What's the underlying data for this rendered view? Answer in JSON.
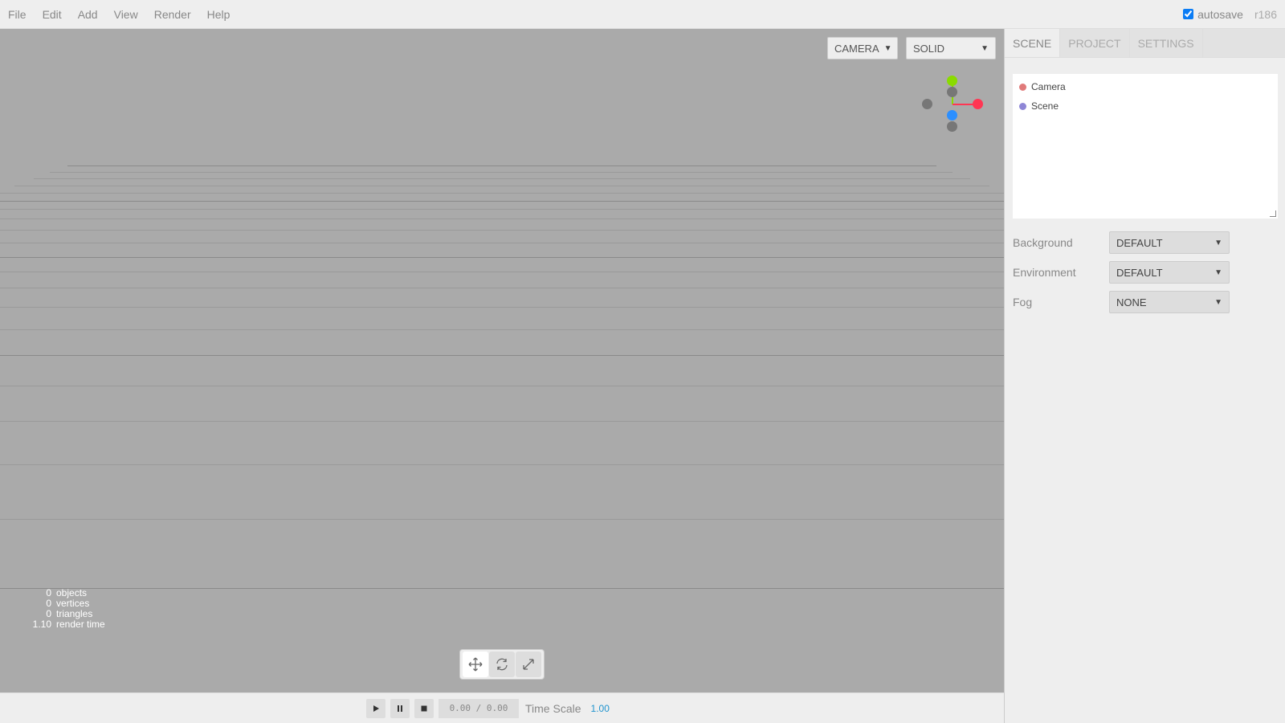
{
  "menubar": {
    "items": [
      "File",
      "Edit",
      "Add",
      "View",
      "Render",
      "Help"
    ],
    "autosave_label": "autosave",
    "autosave_checked": true,
    "version": "r186"
  },
  "viewport": {
    "camera_select": "CAMERA",
    "shading_select": "SOLID",
    "axis_colors": {
      "x": "#ff3653",
      "y": "#8adb00",
      "z": "#2c8fff",
      "neg": "#777777"
    }
  },
  "info": {
    "rows": [
      {
        "value": "0",
        "label": "objects"
      },
      {
        "value": "0",
        "label": "vertices"
      },
      {
        "value": "0",
        "label": "triangles"
      },
      {
        "value": "1.10",
        "label": "render time"
      }
    ]
  },
  "toolbar": {
    "tools": [
      "translate-icon",
      "rotate-icon",
      "scale-icon"
    ],
    "active": "translate-icon"
  },
  "player": {
    "time": "0.00 / 0.00",
    "time_scale_label": "Time Scale",
    "time_scale_value": "1.00"
  },
  "sidebar": {
    "tabs": [
      "SCENE",
      "PROJECT",
      "SETTINGS"
    ],
    "selected_tab": "SCENE",
    "outliner": [
      {
        "label": "Camera",
        "color": "#e07a7a"
      },
      {
        "label": "Scene",
        "color": "#8e86d6"
      }
    ],
    "properties": [
      {
        "label": "Background",
        "value": "DEFAULT"
      },
      {
        "label": "Environment",
        "value": "DEFAULT"
      },
      {
        "label": "Fog",
        "value": "NONE"
      }
    ]
  }
}
